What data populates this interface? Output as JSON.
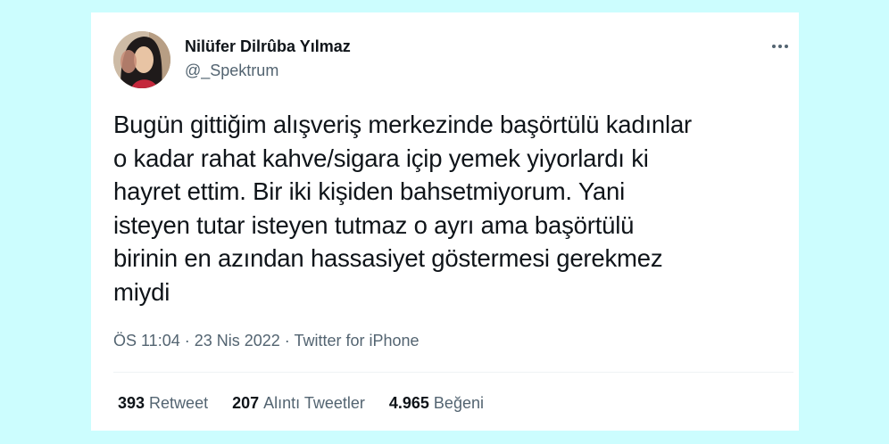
{
  "tweet": {
    "author": {
      "name": "Nilüfer Dilrûba Yılmaz",
      "handle": "@_Spektrum"
    },
    "text": "Bugün gittiğim alışveriş merkezinde başörtülü kadınlar\no kadar rahat kahve/sigara içip yemek yiyorlardı ki\nhayret ettim. Bir iki kişiden bahsetmiyorum. Yani\nisteyen tutar isteyen tutmaz o ayrı ama başörtülü\nbirinin en azından hassasiyet göstermesi gerekmez\nmiydi",
    "time": "ÖS 11:04",
    "date": "23 Nis 2022",
    "source": "Twitter for iPhone",
    "separator": " · ",
    "stats": {
      "retweets_count": "393",
      "retweets_label": "Retweet",
      "quotes_count": "207",
      "quotes_label": "Alıntı Tweetler",
      "likes_count": "4.965",
      "likes_label": "Beğeni"
    }
  },
  "colors": {
    "background": "#ccfdfe",
    "card": "#ffffff",
    "primary_text": "#0f1419",
    "secondary_text": "#536471"
  },
  "icons": {
    "more": "more-horizontal-icon"
  }
}
